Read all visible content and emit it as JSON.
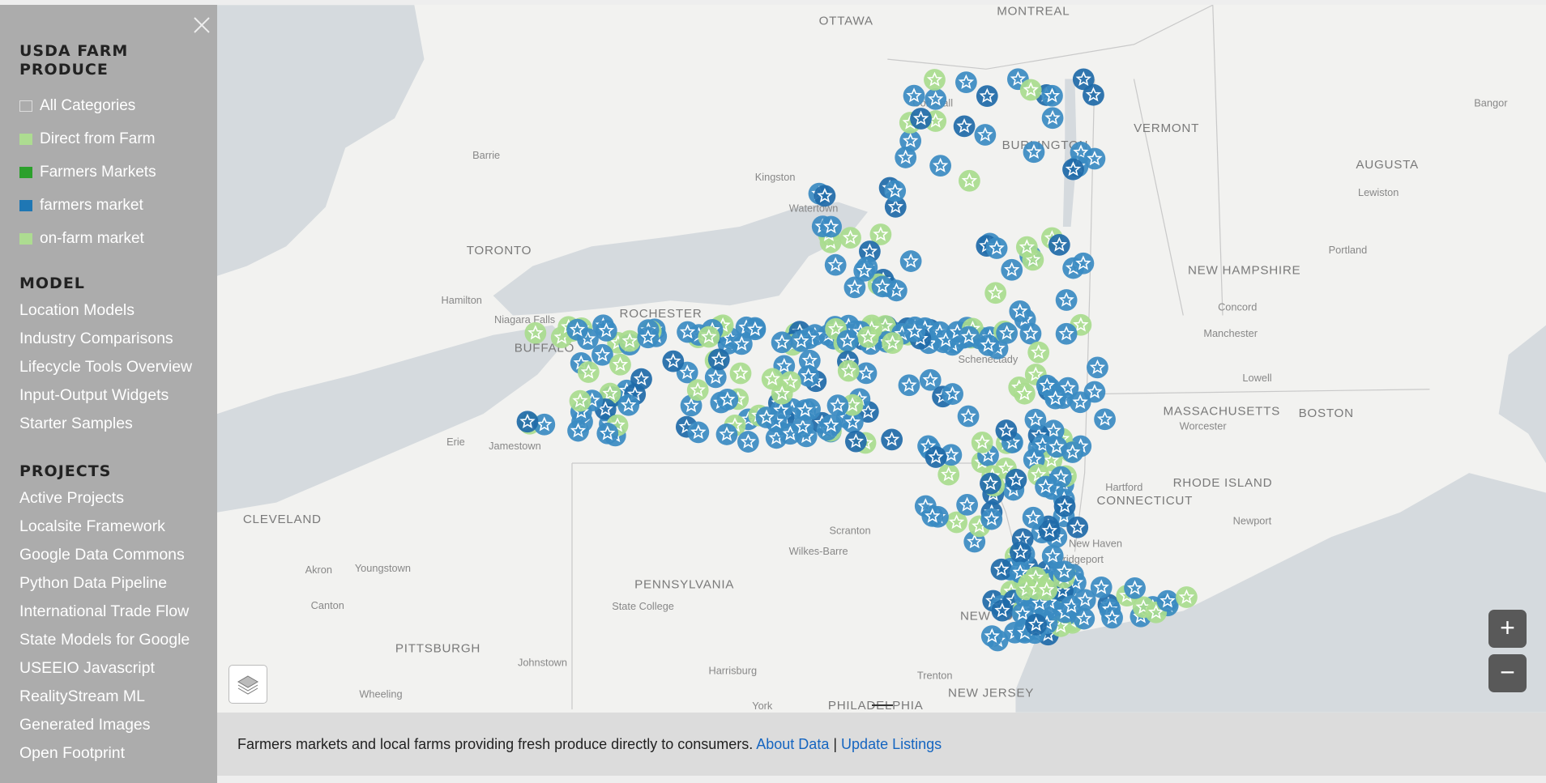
{
  "sidebar": {
    "close_icon": "close-x-icon",
    "title": "USDA FARM PRODUCE",
    "legend": [
      {
        "label": "All Categories",
        "color": "none"
      },
      {
        "label": "Direct from Farm",
        "color": "#addc91"
      },
      {
        "label": "Farmers Markets",
        "color": "#2ca02c"
      },
      {
        "label": "farmers market",
        "color": "#1f77b4"
      },
      {
        "label": "on-farm market",
        "color": "#addc91"
      }
    ],
    "model_title": "MODEL",
    "model_items": [
      "Location Models",
      "Industry Comparisons",
      "Lifecycle Tools Overview",
      "Input-Output Widgets",
      "Starter Samples"
    ],
    "projects_title": "PROJECTS",
    "project_items": [
      "Active Projects",
      "Localsite Framework",
      "Google Data Commons",
      "Python Data Pipeline",
      "International Trade Flow",
      "State Models for Google",
      "USEEIO Javascript",
      "RealityStream ML",
      "Generated Images",
      "Open Footprint"
    ]
  },
  "map": {
    "labels": [
      "OTTAWA",
      "MONTREAL",
      "VERMONT",
      "BURLINGTON",
      "AUGUSTA",
      "Bangor",
      "Lewiston",
      "Portland",
      "NEW HAMPSHIRE",
      "Concord",
      "Manchester",
      "Lowell",
      "MASSACHUSETTS",
      "BOSTON",
      "Worcester",
      "Hartford",
      "CONNECTICUT",
      "RHODE ISLAND",
      "Newport",
      "New Haven",
      "NEW YORK",
      "NEW JERSEY",
      "Trenton",
      "PHILADELPHIA",
      "York",
      "Harrisburg",
      "PENNSYLVANIA",
      "State College",
      "Johnstown",
      "PITTSBURGH",
      "Wheeling",
      "Canton",
      "Akron",
      "Youngstown",
      "CLEVELAND",
      "Erie",
      "Jamestown",
      "BUFFALO",
      "Niagara Falls",
      "Hamilton",
      "TORONTO",
      "Barrie",
      "Kingston",
      "Watertown",
      "Cornwall",
      "Scranton",
      "Wilkes-Barre",
      "Schenectady",
      "ROCHESTER",
      "Bridgeport"
    ],
    "marker_colors": {
      "farmers_market": "#3b8bc2",
      "farmers_market_dark": "#1f6aa8",
      "on_farm": "#a9dc8e"
    },
    "zoom_in": "+",
    "zoom_out": "−",
    "layers_icon": "layers-icon"
  },
  "footer": {
    "text": "Farmers markets and local farms providing fresh produce directly to consumers.",
    "about_link": "About Data",
    "separator": "|",
    "update_link": "Update Listings"
  }
}
